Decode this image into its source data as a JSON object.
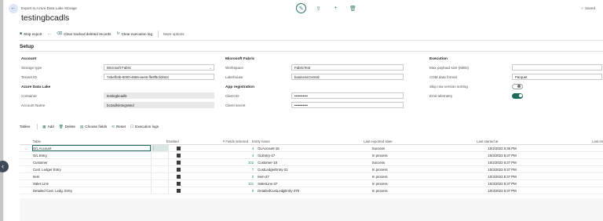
{
  "page": {
    "caption": "Export to Azure Data Lake Storage",
    "title": "testingbcadls",
    "saved_label": "✓ Saved"
  },
  "actions": {
    "stop_export": "Stop export",
    "clear_tracked": "Clear tracked deleted records",
    "clear_log": "Clear execution log",
    "more": "More options"
  },
  "setup": {
    "title": "Setup",
    "account": {
      "group": "Account",
      "storage_type_label": "Storage type",
      "storage_type": "Microsoft Fabric",
      "tenant_id_label": "Tenant ID",
      "tenant_id": "7ebefb3b-5000-4666-aee5-ffe9f5cb3044"
    },
    "azure": {
      "group": "Azure Data Lake",
      "container_label": "Container",
      "container": "testingbcadls",
      "account_name_label": "Account Name",
      "account_name": "bc2adlsintegrated"
    },
    "fabric": {
      "group": "Microsoft Fabric",
      "workspace_label": "Workspace",
      "workspace": "FabricTest",
      "lakehouse_label": "Lakehouse",
      "lakehouse": "businessCentral"
    },
    "app": {
      "group": "App registration",
      "client_id_label": "Client ID",
      "client_id": "•••••••••••",
      "client_secret_label": "Client secret",
      "client_secret": "•••••••••••"
    },
    "execution": {
      "group": "Execution",
      "max_payload_label": "Max payload size (MiBs)",
      "max_payload": "",
      "cdm_format_label": "CDM data format",
      "cdm_format": "Parquet",
      "skip_row_label": "Skip row version sorting",
      "skip_row": false,
      "emit_label": "Emit telemetry",
      "emit": true
    }
  },
  "tables": {
    "label": "Tables",
    "add": "Add",
    "delete": "Delete",
    "choose_fields": "Choose fields",
    "reset": "Reset",
    "exec_logs": "Execution logs",
    "headers": [
      "Table",
      "Enabled",
      "# Fields selected",
      "Entity name",
      "Last exported state",
      "Last started at",
      "Last error"
    ],
    "rows": [
      {
        "table": "G/L Account",
        "enabled": true,
        "fields": "4",
        "entity": "GLAccount-15",
        "state": "Success",
        "started": "10/2/2023 5:35 PM",
        "error": ""
      },
      {
        "table": "G/L Entry",
        "enabled": true,
        "fields": "4",
        "entity": "GLEntry-17",
        "state": "In process",
        "started": "10/3/2023 5:37 PM",
        "error": ""
      },
      {
        "table": "Customer",
        "enabled": true,
        "fields": "102",
        "entity": "Customer-18",
        "state": "Success",
        "started": "10/2/2023 5:37 PM",
        "error": ""
      },
      {
        "table": "Cust. Ledger Entry",
        "enabled": true,
        "fields": "7",
        "entity": "CustLedgerEntry-21",
        "state": "In process",
        "started": "10/3/2023 5:37 PM",
        "error": ""
      },
      {
        "table": "Item",
        "enabled": true,
        "fields": "2",
        "entity": "Item-27",
        "state": "In process",
        "started": "10/3/2023 5:37 PM",
        "error": ""
      },
      {
        "table": "Sales Line",
        "enabled": true,
        "fields": "101",
        "entity": "SalesLine-37",
        "state": "In process",
        "started": "10/3/2023 5:37 PM",
        "error": ""
      },
      {
        "table": "Detailed Cust. Ledg. Entry",
        "enabled": true,
        "fields": "9",
        "entity": "DetailedCustLedgEntry-379",
        "state": "In process",
        "started": "10/3/2023 5:37 PM",
        "error": ""
      }
    ]
  }
}
